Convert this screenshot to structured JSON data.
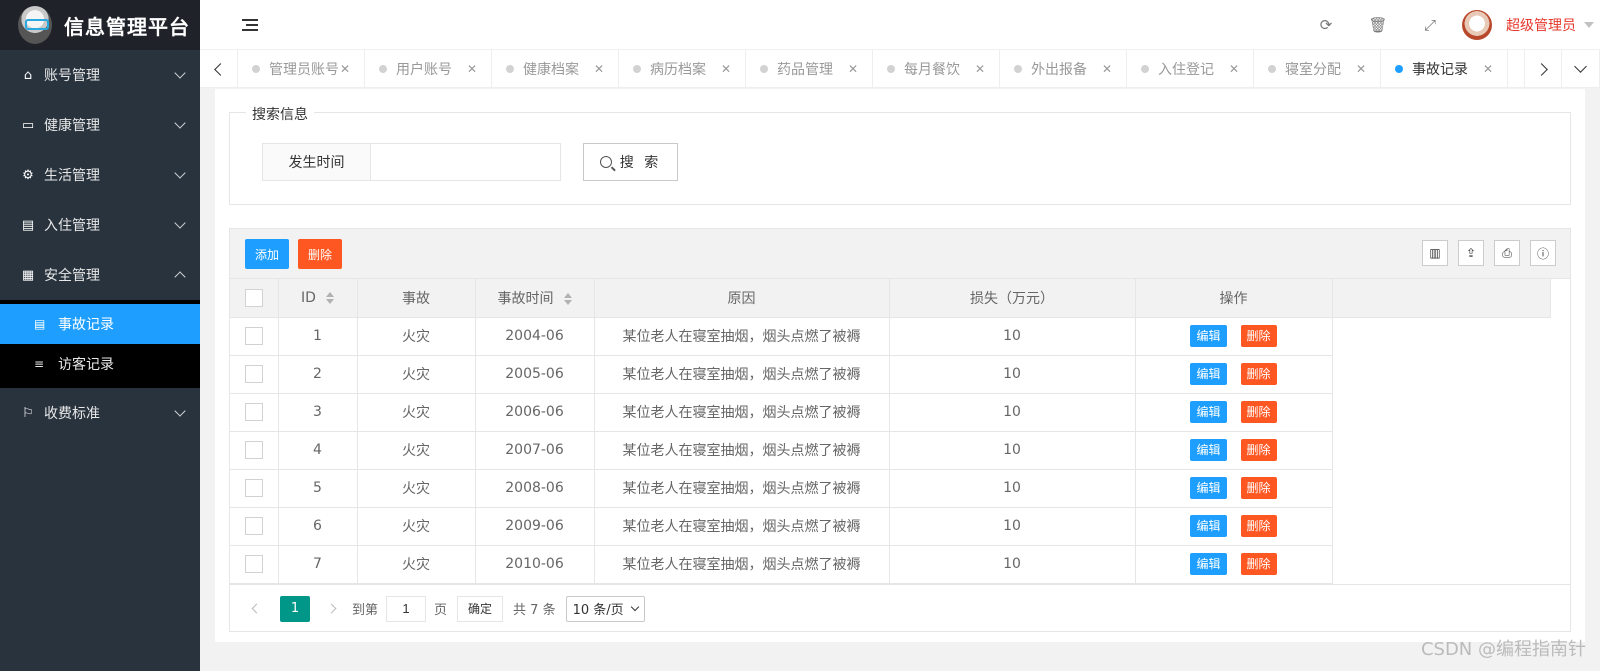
{
  "app": {
    "title": "信息管理平台"
  },
  "sidebar": {
    "items": [
      {
        "label": "账号管理",
        "icon": "home-icon"
      },
      {
        "label": "健康管理",
        "icon": "window-icon"
      },
      {
        "label": "生活管理",
        "icon": "gears-icon"
      },
      {
        "label": "入住管理",
        "icon": "file-icon"
      },
      {
        "label": "安全管理",
        "icon": "calendar-icon"
      }
    ],
    "sub_items": [
      {
        "label": "事故记录",
        "icon": "list-icon"
      },
      {
        "label": "访客记录",
        "icon": "bars-icon"
      }
    ],
    "last_item": {
      "label": "收费标准",
      "icon": "flag-icon"
    }
  },
  "header": {
    "user_name": "超级管理员"
  },
  "tabs": [
    {
      "label": "管理员账号"
    },
    {
      "label": "用户账号"
    },
    {
      "label": "健康档案"
    },
    {
      "label": "病历档案"
    },
    {
      "label": "药品管理"
    },
    {
      "label": "每月餐饮"
    },
    {
      "label": "外出报备"
    },
    {
      "label": "入住登记"
    },
    {
      "label": "寝室分配"
    },
    {
      "label": "事故记录"
    }
  ],
  "search": {
    "legend": "搜索信息",
    "field_label": "发生时间",
    "field_value": "",
    "button_label": "搜 索"
  },
  "toolbar": {
    "add_label": "添加",
    "delete_label": "删除"
  },
  "table": {
    "columns": [
      "ID",
      "事故",
      "事故时间",
      "原因",
      "损失（万元）",
      "操作"
    ],
    "rows": [
      {
        "id": "1",
        "accident": "火灾",
        "time": "2004-06",
        "reason": "某位老人在寝室抽烟，烟头点燃了被褥",
        "loss": "10"
      },
      {
        "id": "2",
        "accident": "火灾",
        "time": "2005-06",
        "reason": "某位老人在寝室抽烟，烟头点燃了被褥",
        "loss": "10"
      },
      {
        "id": "3",
        "accident": "火灾",
        "time": "2006-06",
        "reason": "某位老人在寝室抽烟，烟头点燃了被褥",
        "loss": "10"
      },
      {
        "id": "4",
        "accident": "火灾",
        "time": "2007-06",
        "reason": "某位老人在寝室抽烟，烟头点燃了被褥",
        "loss": "10"
      },
      {
        "id": "5",
        "accident": "火灾",
        "time": "2008-06",
        "reason": "某位老人在寝室抽烟，烟头点燃了被褥",
        "loss": "10"
      },
      {
        "id": "6",
        "accident": "火灾",
        "time": "2009-06",
        "reason": "某位老人在寝室抽烟，烟头点燃了被褥",
        "loss": "10"
      },
      {
        "id": "7",
        "accident": "火灾",
        "time": "2010-06",
        "reason": "某位老人在寝室抽烟，烟头点燃了被褥",
        "loss": "10"
      }
    ],
    "edit_label": "编辑",
    "delete_label": "删除"
  },
  "pager": {
    "current": "1",
    "goto_label": "到第",
    "goto_value": "1",
    "page_unit": "页",
    "confirm_label": "确定",
    "total_label": "共 7 条",
    "page_size_label": "10 条/页"
  },
  "watermark": "CSDN @编程指南针",
  "colors": {
    "accent": "#1e9fff",
    "danger": "#ff5722",
    "pager": "#009688",
    "user": "#e5372a",
    "sidebar": "#28333e"
  }
}
